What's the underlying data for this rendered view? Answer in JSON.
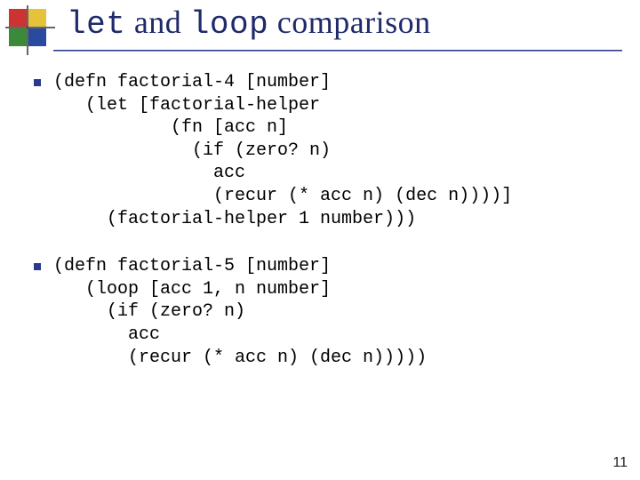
{
  "title": {
    "part1_mono": "let",
    "part2_plain": " and ",
    "part3_mono": "loop",
    "part4_plain": "  comparison"
  },
  "blocks": [
    {
      "code": "(defn factorial-4 [number]\n   (let [factorial-helper\n           (fn [acc n]\n             (if (zero? n)\n               acc\n               (recur (* acc n) (dec n))))]\n     (factorial-helper 1 number)))"
    },
    {
      "code": "(defn factorial-5 [number]\n   (loop [acc 1, n number]\n     (if (zero? n)\n       acc\n       (recur (* acc n) (dec n)))))"
    }
  ],
  "page_number": "11",
  "logo_colors": {
    "red": "#cc3333",
    "yellow": "#e6c23a",
    "green": "#3a8a3a",
    "blue": "#2a4aa0",
    "line": "#333333"
  }
}
